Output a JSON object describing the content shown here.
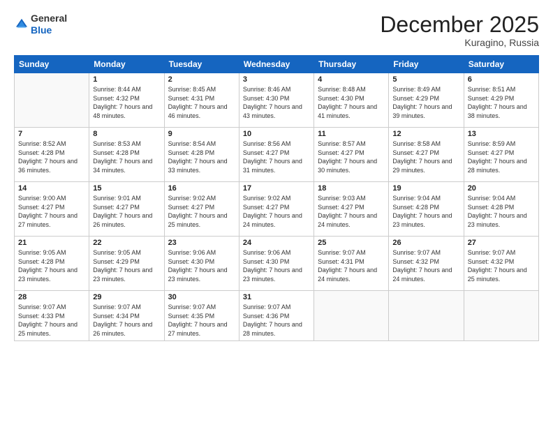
{
  "header": {
    "logo_line1": "General",
    "logo_line2": "Blue",
    "month_title": "December 2025",
    "location": "Kuragino, Russia"
  },
  "days_of_week": [
    "Sunday",
    "Monday",
    "Tuesday",
    "Wednesday",
    "Thursday",
    "Friday",
    "Saturday"
  ],
  "weeks": [
    [
      {
        "day": "",
        "sunrise": "",
        "sunset": "",
        "daylight": ""
      },
      {
        "day": "1",
        "sunrise": "Sunrise: 8:44 AM",
        "sunset": "Sunset: 4:32 PM",
        "daylight": "Daylight: 7 hours and 48 minutes."
      },
      {
        "day": "2",
        "sunrise": "Sunrise: 8:45 AM",
        "sunset": "Sunset: 4:31 PM",
        "daylight": "Daylight: 7 hours and 46 minutes."
      },
      {
        "day": "3",
        "sunrise": "Sunrise: 8:46 AM",
        "sunset": "Sunset: 4:30 PM",
        "daylight": "Daylight: 7 hours and 43 minutes."
      },
      {
        "day": "4",
        "sunrise": "Sunrise: 8:48 AM",
        "sunset": "Sunset: 4:30 PM",
        "daylight": "Daylight: 7 hours and 41 minutes."
      },
      {
        "day": "5",
        "sunrise": "Sunrise: 8:49 AM",
        "sunset": "Sunset: 4:29 PM",
        "daylight": "Daylight: 7 hours and 39 minutes."
      },
      {
        "day": "6",
        "sunrise": "Sunrise: 8:51 AM",
        "sunset": "Sunset: 4:29 PM",
        "daylight": "Daylight: 7 hours and 38 minutes."
      }
    ],
    [
      {
        "day": "7",
        "sunrise": "Sunrise: 8:52 AM",
        "sunset": "Sunset: 4:28 PM",
        "daylight": "Daylight: 7 hours and 36 minutes."
      },
      {
        "day": "8",
        "sunrise": "Sunrise: 8:53 AM",
        "sunset": "Sunset: 4:28 PM",
        "daylight": "Daylight: 7 hours and 34 minutes."
      },
      {
        "day": "9",
        "sunrise": "Sunrise: 8:54 AM",
        "sunset": "Sunset: 4:28 PM",
        "daylight": "Daylight: 7 hours and 33 minutes."
      },
      {
        "day": "10",
        "sunrise": "Sunrise: 8:56 AM",
        "sunset": "Sunset: 4:27 PM",
        "daylight": "Daylight: 7 hours and 31 minutes."
      },
      {
        "day": "11",
        "sunrise": "Sunrise: 8:57 AM",
        "sunset": "Sunset: 4:27 PM",
        "daylight": "Daylight: 7 hours and 30 minutes."
      },
      {
        "day": "12",
        "sunrise": "Sunrise: 8:58 AM",
        "sunset": "Sunset: 4:27 PM",
        "daylight": "Daylight: 7 hours and 29 minutes."
      },
      {
        "day": "13",
        "sunrise": "Sunrise: 8:59 AM",
        "sunset": "Sunset: 4:27 PM",
        "daylight": "Daylight: 7 hours and 28 minutes."
      }
    ],
    [
      {
        "day": "14",
        "sunrise": "Sunrise: 9:00 AM",
        "sunset": "Sunset: 4:27 PM",
        "daylight": "Daylight: 7 hours and 27 minutes."
      },
      {
        "day": "15",
        "sunrise": "Sunrise: 9:01 AM",
        "sunset": "Sunset: 4:27 PM",
        "daylight": "Daylight: 7 hours and 26 minutes."
      },
      {
        "day": "16",
        "sunrise": "Sunrise: 9:02 AM",
        "sunset": "Sunset: 4:27 PM",
        "daylight": "Daylight: 7 hours and 25 minutes."
      },
      {
        "day": "17",
        "sunrise": "Sunrise: 9:02 AM",
        "sunset": "Sunset: 4:27 PM",
        "daylight": "Daylight: 7 hours and 24 minutes."
      },
      {
        "day": "18",
        "sunrise": "Sunrise: 9:03 AM",
        "sunset": "Sunset: 4:27 PM",
        "daylight": "Daylight: 7 hours and 24 minutes."
      },
      {
        "day": "19",
        "sunrise": "Sunrise: 9:04 AM",
        "sunset": "Sunset: 4:28 PM",
        "daylight": "Daylight: 7 hours and 23 minutes."
      },
      {
        "day": "20",
        "sunrise": "Sunrise: 9:04 AM",
        "sunset": "Sunset: 4:28 PM",
        "daylight": "Daylight: 7 hours and 23 minutes."
      }
    ],
    [
      {
        "day": "21",
        "sunrise": "Sunrise: 9:05 AM",
        "sunset": "Sunset: 4:28 PM",
        "daylight": "Daylight: 7 hours and 23 minutes."
      },
      {
        "day": "22",
        "sunrise": "Sunrise: 9:05 AM",
        "sunset": "Sunset: 4:29 PM",
        "daylight": "Daylight: 7 hours and 23 minutes."
      },
      {
        "day": "23",
        "sunrise": "Sunrise: 9:06 AM",
        "sunset": "Sunset: 4:30 PM",
        "daylight": "Daylight: 7 hours and 23 minutes."
      },
      {
        "day": "24",
        "sunrise": "Sunrise: 9:06 AM",
        "sunset": "Sunset: 4:30 PM",
        "daylight": "Daylight: 7 hours and 23 minutes."
      },
      {
        "day": "25",
        "sunrise": "Sunrise: 9:07 AM",
        "sunset": "Sunset: 4:31 PM",
        "daylight": "Daylight: 7 hours and 24 minutes."
      },
      {
        "day": "26",
        "sunrise": "Sunrise: 9:07 AM",
        "sunset": "Sunset: 4:32 PM",
        "daylight": "Daylight: 7 hours and 24 minutes."
      },
      {
        "day": "27",
        "sunrise": "Sunrise: 9:07 AM",
        "sunset": "Sunset: 4:32 PM",
        "daylight": "Daylight: 7 hours and 25 minutes."
      }
    ],
    [
      {
        "day": "28",
        "sunrise": "Sunrise: 9:07 AM",
        "sunset": "Sunset: 4:33 PM",
        "daylight": "Daylight: 7 hours and 25 minutes."
      },
      {
        "day": "29",
        "sunrise": "Sunrise: 9:07 AM",
        "sunset": "Sunset: 4:34 PM",
        "daylight": "Daylight: 7 hours and 26 minutes."
      },
      {
        "day": "30",
        "sunrise": "Sunrise: 9:07 AM",
        "sunset": "Sunset: 4:35 PM",
        "daylight": "Daylight: 7 hours and 27 minutes."
      },
      {
        "day": "31",
        "sunrise": "Sunrise: 9:07 AM",
        "sunset": "Sunset: 4:36 PM",
        "daylight": "Daylight: 7 hours and 28 minutes."
      },
      {
        "day": "",
        "sunrise": "",
        "sunset": "",
        "daylight": ""
      },
      {
        "day": "",
        "sunrise": "",
        "sunset": "",
        "daylight": ""
      },
      {
        "day": "",
        "sunrise": "",
        "sunset": "",
        "daylight": ""
      }
    ]
  ]
}
